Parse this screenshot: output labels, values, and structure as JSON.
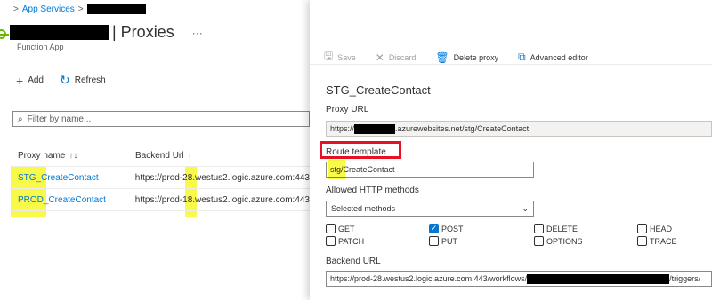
{
  "breadcrumb": {
    "root": "App Services"
  },
  "header": {
    "title": "| Proxies",
    "more": "···",
    "subtitle": "Function App"
  },
  "toolbar": {
    "add_label": "Add",
    "refresh_label": "Refresh"
  },
  "filter": {
    "placeholder": "Filter by name..."
  },
  "table": {
    "columns": [
      "Proxy name",
      "Backend Url"
    ],
    "rows": [
      {
        "name": "STG_CreateContact",
        "backend": "https://prod-28.westus2.logic.azure.com:443"
      },
      {
        "name": "PROD_CreateContact",
        "backend": "https://prod-18.westus2.logic.azure.com:443"
      }
    ]
  },
  "panel": {
    "toolbar": {
      "save": "Save",
      "discard": "Discard",
      "delete": "Delete proxy",
      "advanced": "Advanced editor"
    },
    "title": "STG_CreateContact",
    "proxy_url_label": "Proxy URL",
    "proxy_url_prefix": "https://",
    "proxy_url_suffix": ".azurewebsites.net/stg/CreateContact",
    "route_label": "Route template",
    "route_value": "stg/CreateContact",
    "methods_label": "Allowed HTTP methods",
    "methods_value": "Selected methods",
    "methods": [
      {
        "label": "GET",
        "checked": false
      },
      {
        "label": "POST",
        "checked": true
      },
      {
        "label": "DELETE",
        "checked": false
      },
      {
        "label": "HEAD",
        "checked": false
      },
      {
        "label": "PATCH",
        "checked": false
      },
      {
        "label": "PUT",
        "checked": false
      },
      {
        "label": "OPTIONS",
        "checked": false
      },
      {
        "label": "TRACE",
        "checked": false
      }
    ],
    "backend_label": "Backend URL",
    "backend_prefix": "https://prod-28.westus2.logic.azure.com:443/workflows/",
    "backend_suffix": "/triggers/"
  },
  "colors": {
    "accent": "#0078d4",
    "highlight": "#f9f94a",
    "callout": "#e81123"
  }
}
